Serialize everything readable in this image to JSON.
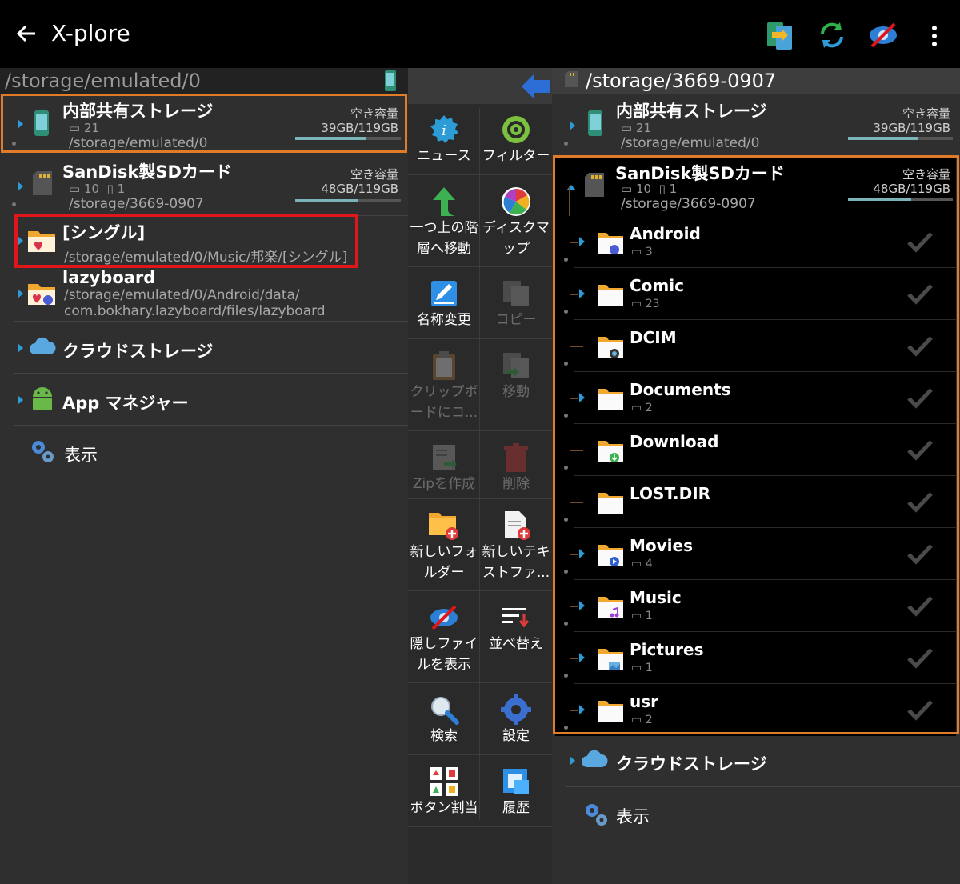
{
  "app": {
    "title": "X-plore",
    "back_icon": "back-arrow-icon"
  },
  "toolbar_icons": [
    "copy-to-device-icon",
    "sync-icon",
    "hidden-files-icon",
    "more-options-icon"
  ],
  "left_panel": {
    "path": "/storage/emulated/0",
    "entries": [
      {
        "name": "内部共有ストレージ",
        "count": "21",
        "free_label": "空き容量",
        "free": "39GB/119GB",
        "path": "/storage/emulated/0",
        "usage": 0.67
      },
      {
        "name": "SanDisk製SDカード",
        "count": "10",
        "files": "1",
        "free_label": "空き容量",
        "free": "48GB/119GB",
        "path": "/storage/3669-0907",
        "usage": 0.6
      },
      {
        "name": "[シングル]",
        "path": "/storage/emulated/0/Music/邦楽/[シングル]"
      },
      {
        "name": "lazyboard",
        "path1": "/storage/emulated/0/Android/data/",
        "path2": "com.bokhary.lazyboard/files/lazyboard"
      },
      {
        "name": "クラウドストレージ"
      },
      {
        "name": "App マネジャー"
      },
      {
        "name": "表示"
      }
    ]
  },
  "tools": [
    {
      "label1": "ニュース",
      "label2": "",
      "icon": "news-info-icon",
      "enabled": true
    },
    {
      "label1": "フィルター",
      "label2": "",
      "icon": "filter-icon",
      "enabled": true
    },
    {
      "label1": "一つ上の階",
      "label2": "層へ移動",
      "icon": "up-arrow-icon",
      "enabled": true
    },
    {
      "label1": "ディスクマ",
      "label2": "ップ",
      "icon": "disk-map-icon",
      "enabled": true
    },
    {
      "label1": "名称変更",
      "label2": "",
      "icon": "rename-icon",
      "enabled": true
    },
    {
      "label1": "コピー",
      "label2": "",
      "icon": "copy-icon",
      "enabled": false
    },
    {
      "label1": "クリップボ",
      "label2": "ードにコ...",
      "icon": "clipboard-icon",
      "enabled": false
    },
    {
      "label1": "移動",
      "label2": "",
      "icon": "move-icon",
      "enabled": false
    },
    {
      "label1": "Zipを作成",
      "label2": "",
      "icon": "zip-icon",
      "enabled": false
    },
    {
      "label1": "削除",
      "label2": "",
      "icon": "trash-icon",
      "enabled": false
    },
    {
      "label1": "新しいフォ",
      "label2": "ルダー",
      "icon": "new-folder-icon",
      "enabled": true
    },
    {
      "label1": "新しいテキ",
      "label2": "ストファ...",
      "icon": "new-text-file-icon",
      "enabled": true
    },
    {
      "label1": "隠しファイ",
      "label2": "ルを表示",
      "icon": "hidden-files-icon",
      "enabled": true
    },
    {
      "label1": "並べ替え",
      "label2": "",
      "icon": "sort-icon",
      "enabled": true
    },
    {
      "label1": "検索",
      "label2": "",
      "icon": "search-icon",
      "enabled": true
    },
    {
      "label1": "設定",
      "label2": "",
      "icon": "settings-gear-icon",
      "enabled": true
    },
    {
      "label1": "ボタン割当",
      "label2": "",
      "icon": "button-assign-icon",
      "enabled": true
    },
    {
      "label1": "履歴",
      "label2": "",
      "icon": "history-icon",
      "enabled": true
    }
  ],
  "right_panel": {
    "path": "/storage/3669-0907",
    "internal": {
      "name": "内部共有ストレージ",
      "count": "21",
      "free_label": "空き容量",
      "free": "39GB/119GB",
      "path": "/storage/emulated/0",
      "usage": 0.67
    },
    "sdcard": {
      "name": "SanDisk製SDカード",
      "count": "10",
      "files": "1",
      "free_label": "空き容量",
      "free": "48GB/119GB",
      "path": "/storage/3669-0907",
      "usage": 0.6
    },
    "folders": [
      {
        "name": "Android",
        "count": "3",
        "badge": "android"
      },
      {
        "name": "Comic",
        "count": "23",
        "badge": ""
      },
      {
        "name": "DCIM",
        "count": "",
        "badge": "camera"
      },
      {
        "name": "Documents",
        "count": "2",
        "badge": ""
      },
      {
        "name": "Download",
        "count": "",
        "badge": "download"
      },
      {
        "name": "LOST.DIR",
        "count": "",
        "badge": ""
      },
      {
        "name": "Movies",
        "count": "4",
        "badge": "movie"
      },
      {
        "name": "Music",
        "count": "1",
        "badge": "music"
      },
      {
        "name": "Pictures",
        "count": "1",
        "badge": "picture"
      },
      {
        "name": "usr",
        "count": "2",
        "badge": ""
      }
    ],
    "cloud": "クラウドストレージ",
    "display": "表示"
  },
  "colors": {
    "accent": "#2d9bd6",
    "highlight_red": "#e0161b",
    "highlight_orange": "#e07b2a",
    "usage_bar": "#7ab3b8"
  }
}
